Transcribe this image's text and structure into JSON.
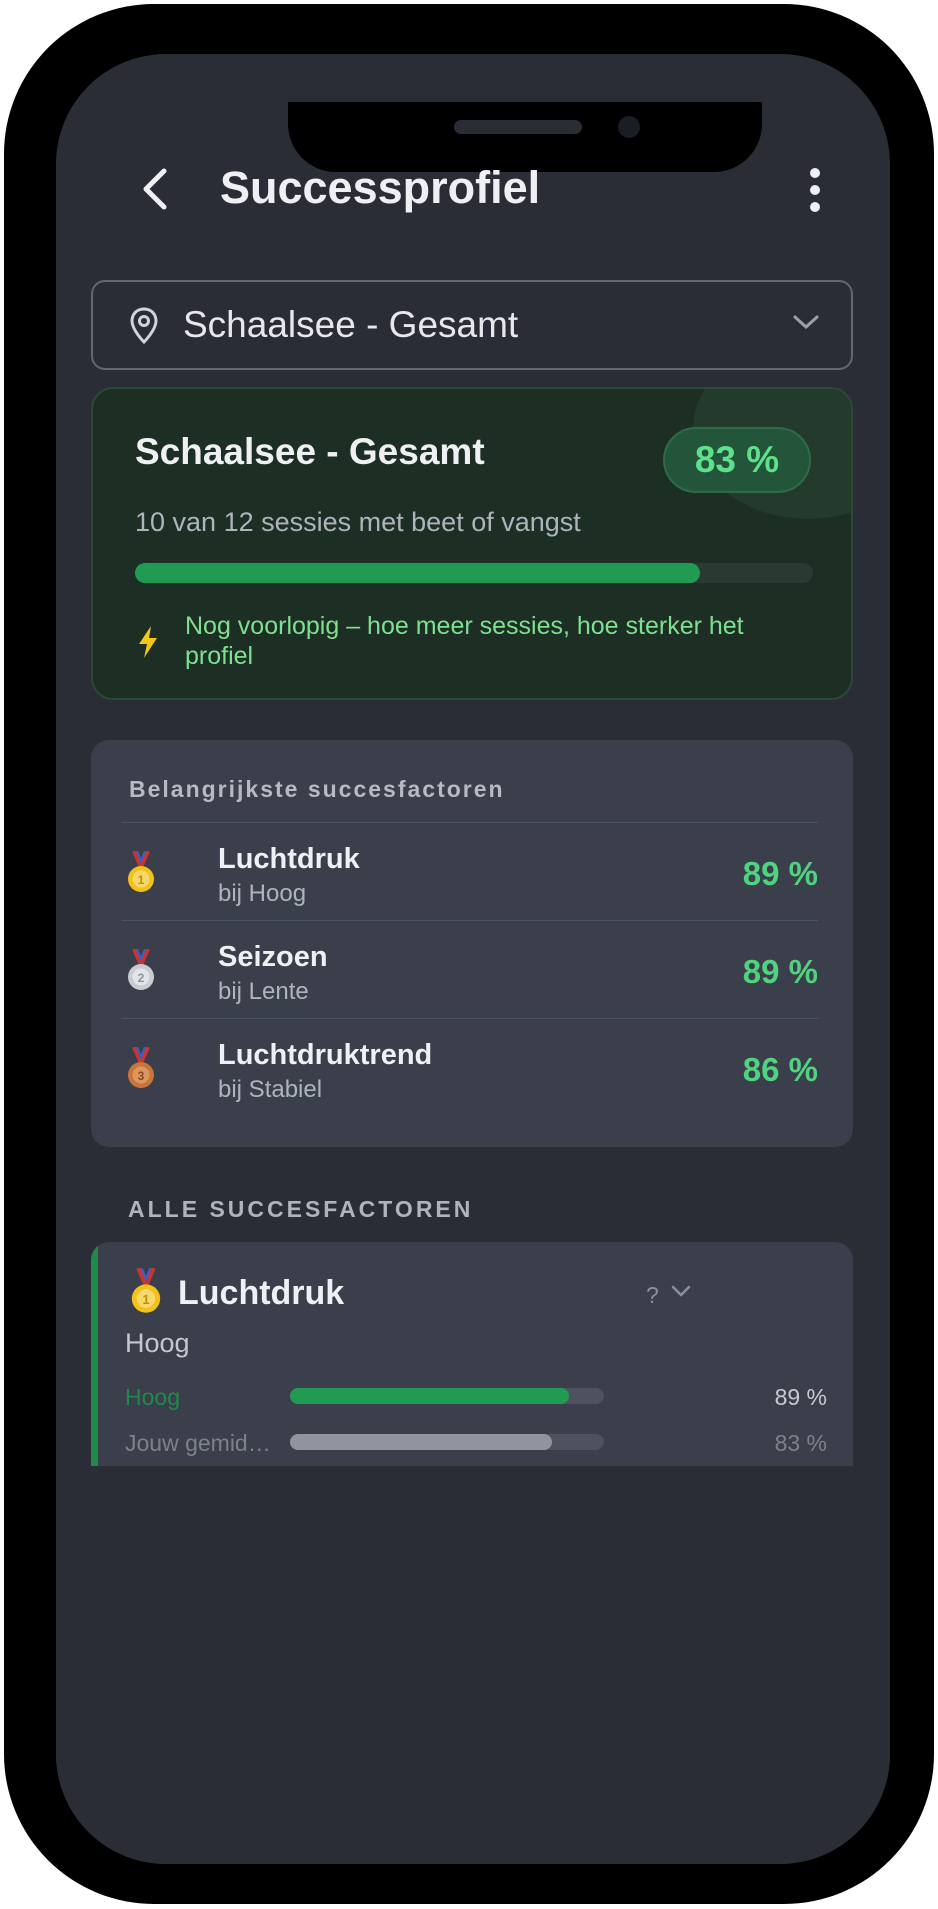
{
  "header": {
    "title": "Successprofiel",
    "back_icon": "back-arrow-icon",
    "menu_icon": "more-vertical-icon"
  },
  "location_selector": {
    "value": "Schaalsee - Gesamt",
    "icon": "location-pin-icon",
    "chevron": "chevron-down-icon"
  },
  "summary": {
    "title": "Schaalsee - Gesamt",
    "percent_label": "83 %",
    "sessions_text": "10 van 12 sessies met beet of vangst",
    "progress": 0.833,
    "note": "Nog voorlopig – hoe meer sessies, hoe sterker het profiel",
    "note_icon": "lightning-bolt-icon",
    "accent_color": "#219a52"
  },
  "top_factors": {
    "title": "Belangrijkste succesfactoren",
    "items": [
      {
        "name": "Luchtdruk",
        "condition": "bij Hoog",
        "percent": "89 %",
        "medal": "gold-medal-icon"
      },
      {
        "name": "Seizoen",
        "condition": "bij Lente",
        "percent": "89 %",
        "medal": "silver-medal-icon"
      },
      {
        "name": "Luchtdruktrend",
        "condition": "bij Stabiel",
        "percent": "86 %",
        "medal": "bronze-medal-icon"
      }
    ]
  },
  "all_factors": {
    "title": "ALLE SUCCESFACTOREN",
    "first": {
      "name": "Luchtdruk",
      "condition": "Hoog",
      "help": "?",
      "rows": [
        {
          "label": "Hoog",
          "percent": "89 %",
          "value": 0.89,
          "color": "#219a52"
        },
        {
          "label": "Jouw gemid…",
          "percent": "83 %",
          "value": 0.833,
          "color": "#8f949e"
        }
      ]
    }
  }
}
